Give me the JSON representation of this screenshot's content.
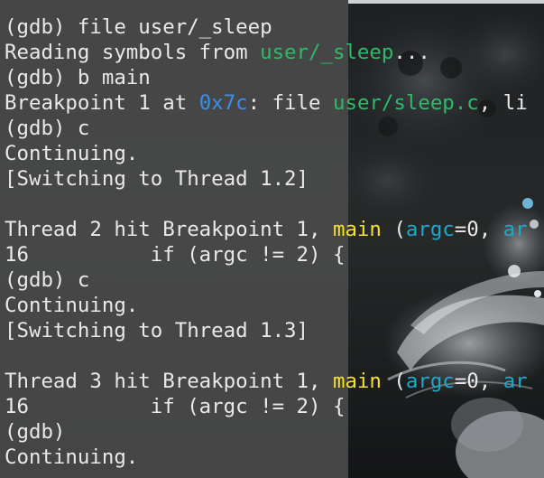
{
  "colors": {
    "terminal_text": "#e9e9e9",
    "terminal_panel": "#4a4a4a",
    "filename_green": "#2fba6a",
    "address_blue": "#3b8eea",
    "function_yellow": "#f5e22b",
    "arg_cyan": "#1fa8c9"
  },
  "terminal": {
    "lines": [
      [
        {
          "text": "(gdb) file user/_sleep",
          "color": ""
        }
      ],
      [
        {
          "text": "Reading symbols from ",
          "color": ""
        },
        {
          "text": "user/_sleep",
          "color": "green"
        },
        {
          "text": "...",
          "color": ""
        }
      ],
      [
        {
          "text": "(gdb) b main",
          "color": ""
        }
      ],
      [
        {
          "text": "Breakpoint 1 at ",
          "color": ""
        },
        {
          "text": "0x7c",
          "color": "blue"
        },
        {
          "text": ": file ",
          "color": ""
        },
        {
          "text": "user/sleep.c",
          "color": "green"
        },
        {
          "text": ", li",
          "color": ""
        }
      ],
      [
        {
          "text": "(gdb) c",
          "color": ""
        }
      ],
      [
        {
          "text": "Continuing.",
          "color": ""
        }
      ],
      [
        {
          "text": "[Switching to Thread 1.2]",
          "color": ""
        }
      ],
      [
        {
          "text": "",
          "color": ""
        }
      ],
      [
        {
          "text": "Thread 2 hit Breakpoint 1, ",
          "color": ""
        },
        {
          "text": "main",
          "color": "yellow"
        },
        {
          "text": " (",
          "color": ""
        },
        {
          "text": "argc",
          "color": "cyan"
        },
        {
          "text": "=0, ",
          "color": ""
        },
        {
          "text": "ar",
          "color": "cyan"
        }
      ],
      [
        {
          "text": "16          if (argc != 2) {",
          "color": ""
        }
      ],
      [
        {
          "text": "(gdb) c",
          "color": ""
        }
      ],
      [
        {
          "text": "Continuing.",
          "color": ""
        }
      ],
      [
        {
          "text": "[Switching to Thread 1.3]",
          "color": ""
        }
      ],
      [
        {
          "text": "",
          "color": ""
        }
      ],
      [
        {
          "text": "Thread 3 hit Breakpoint 1, ",
          "color": ""
        },
        {
          "text": "main",
          "color": "yellow"
        },
        {
          "text": " (",
          "color": ""
        },
        {
          "text": "argc",
          "color": "cyan"
        },
        {
          "text": "=0, ",
          "color": ""
        },
        {
          "text": "ar",
          "color": "cyan"
        }
      ],
      [
        {
          "text": "16          if (argc != 2) {",
          "color": ""
        }
      ],
      [
        {
          "text": "(gdb)",
          "color": ""
        }
      ],
      [
        {
          "text": "Continuing.",
          "color": ""
        }
      ]
    ]
  }
}
